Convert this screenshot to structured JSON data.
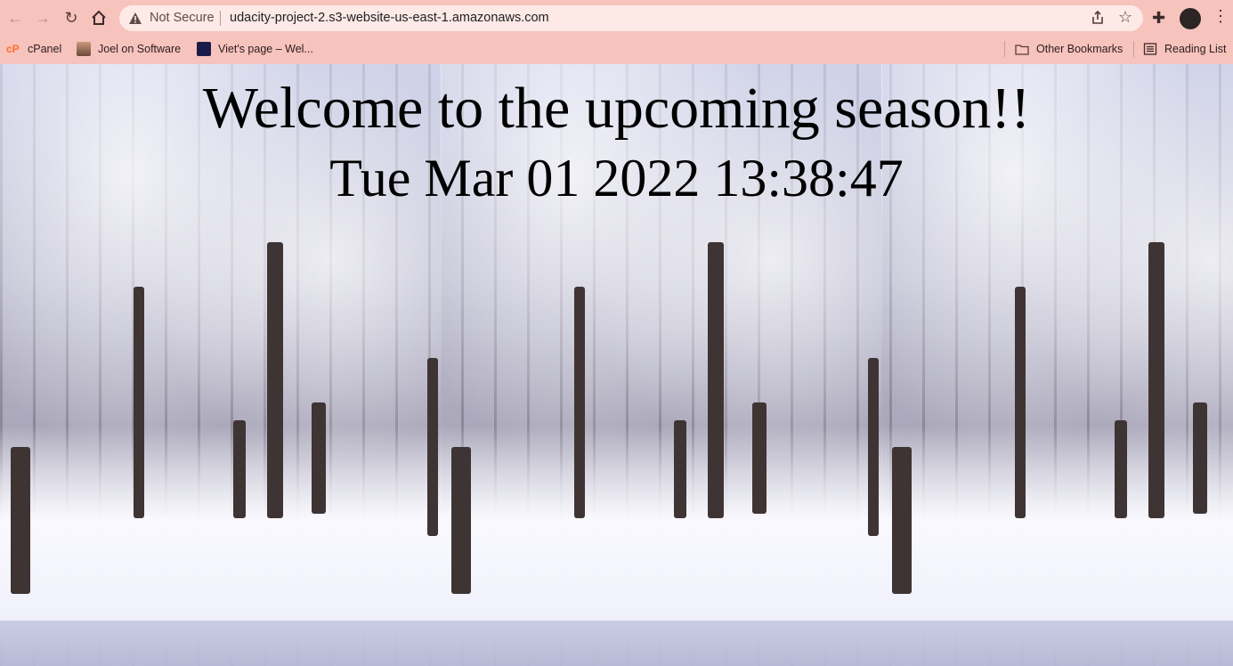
{
  "browser": {
    "security_label": "Not Secure",
    "url": "udacity-project-2.s3-website-us-east-1.amazonaws.com",
    "bookmarks": [
      {
        "label": "cPanel",
        "icon": "cpanel-icon"
      },
      {
        "label": "Joel on Software",
        "icon": "joel-avatar-icon"
      },
      {
        "label": "Viet's page – Wel...",
        "icon": "viet-icon"
      }
    ],
    "other_bookmarks_label": "Other Bookmarks",
    "reading_list_label": "Reading List",
    "colors": {
      "chrome": "#f7c3bd",
      "omnibox": "#fde9e6"
    }
  },
  "page": {
    "welcome_text": "Welcome to the upcoming season!!",
    "datetime_text": "Tue Mar 01 2022 13:38:47",
    "background": "snowy-forest-image"
  }
}
